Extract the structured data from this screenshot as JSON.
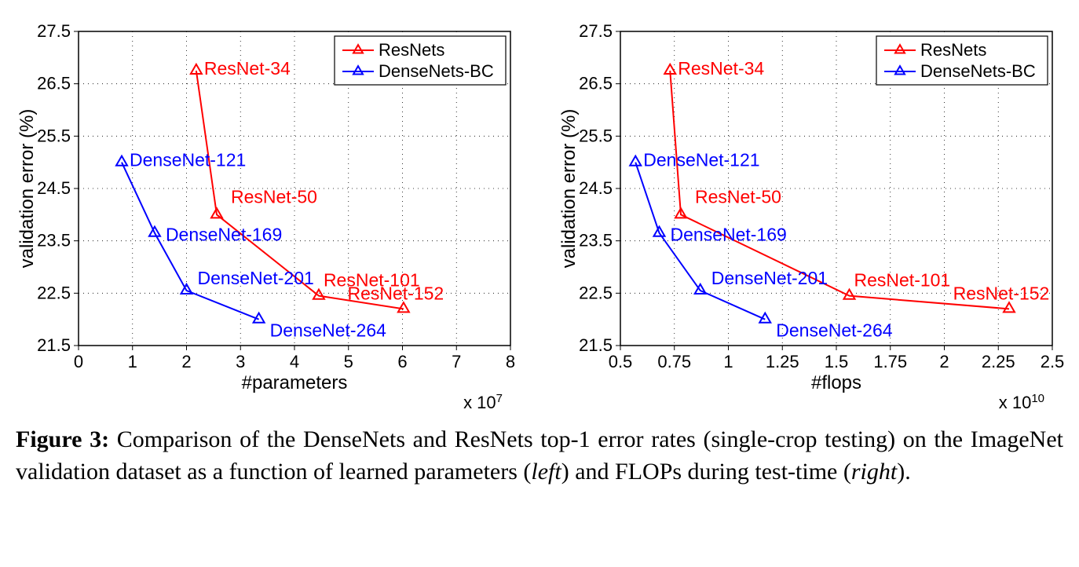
{
  "caption": {
    "lead": "Figure 3:",
    "body": " Comparison of the DenseNets and ResNets top-1 error rates (single-crop testing) on the ImageNet validation dataset as a function of learned parameters (",
    "left": "left",
    "mid": ") and FLOPs during test-time (",
    "right": "right",
    "end": ")."
  },
  "legend": {
    "resnets": "ResNets",
    "densenets": "DenseNets-BC"
  },
  "left_chart": {
    "ylabel": "validation error (%)",
    "xlabel": "#parameters",
    "exp": "x 10",
    "exp_sup": "7",
    "xticks": [
      "0",
      "1",
      "2",
      "3",
      "4",
      "5",
      "6",
      "7",
      "8"
    ],
    "yticks": [
      "21.5",
      "22.5",
      "23.5",
      "24.5",
      "25.5",
      "26.5",
      "27.5"
    ],
    "points": {
      "r34": "ResNet-34",
      "r50": "ResNet-50",
      "r101": "ResNet-101",
      "r152": "ResNet-152",
      "d121": "DenseNet-121",
      "d169": "DenseNet-169",
      "d201": "DenseNet-201",
      "d264": "DenseNet-264"
    }
  },
  "right_chart": {
    "ylabel": "validation error (%)",
    "xlabel": "#flops",
    "exp": "x 10",
    "exp_sup": "10",
    "xticks": [
      "0.5",
      "0.75",
      "1",
      "1.25",
      "1.5",
      "1.75",
      "2",
      "2.25",
      "2.5"
    ],
    "yticks": [
      "21.5",
      "22.5",
      "23.5",
      "24.5",
      "25.5",
      "26.5",
      "27.5"
    ],
    "points": {
      "r34": "ResNet-34",
      "r50": "ResNet-50",
      "r101": "ResNet-101",
      "r152": "ResNet-152",
      "d121": "DenseNet-121",
      "d169": "DenseNet-169",
      "d201": "DenseNet-201",
      "d264": "DenseNet-264"
    }
  },
  "chart_data": [
    {
      "type": "line",
      "title": "",
      "xlabel": "#parameters (x 10^7)",
      "ylabel": "validation error (%)",
      "xlim": [
        0,
        8
      ],
      "ylim": [
        21.5,
        27.5
      ],
      "legend_position": "top-right",
      "grid": true,
      "series": [
        {
          "name": "ResNets",
          "color": "#ff0000",
          "points": [
            {
              "label": "ResNet-34",
              "x": 2.18,
              "y": 26.75
            },
            {
              "label": "ResNet-50",
              "x": 2.56,
              "y": 24.0
            },
            {
              "label": "ResNet-101",
              "x": 4.45,
              "y": 22.45
            },
            {
              "label": "ResNet-152",
              "x": 6.02,
              "y": 22.2
            }
          ]
        },
        {
          "name": "DenseNets-BC",
          "color": "#0000ff",
          "points": [
            {
              "label": "DenseNet-121",
              "x": 0.8,
              "y": 25.0
            },
            {
              "label": "DenseNet-169",
              "x": 1.41,
              "y": 23.65
            },
            {
              "label": "DenseNet-201",
              "x": 2.0,
              "y": 22.55
            },
            {
              "label": "DenseNet-264",
              "x": 3.34,
              "y": 22.0
            }
          ]
        }
      ]
    },
    {
      "type": "line",
      "title": "",
      "xlabel": "#flops (x 10^10)",
      "ylabel": "validation error (%)",
      "xlim": [
        0.5,
        2.5
      ],
      "ylim": [
        21.5,
        27.5
      ],
      "legend_position": "top-right",
      "grid": true,
      "series": [
        {
          "name": "ResNets",
          "color": "#ff0000",
          "points": [
            {
              "label": "ResNet-34",
              "x": 0.73,
              "y": 26.75
            },
            {
              "label": "ResNet-50",
              "x": 0.78,
              "y": 24.0
            },
            {
              "label": "ResNet-101",
              "x": 1.56,
              "y": 22.45
            },
            {
              "label": "ResNet-152",
              "x": 2.3,
              "y": 22.2
            }
          ]
        },
        {
          "name": "DenseNets-BC",
          "color": "#0000ff",
          "points": [
            {
              "label": "DenseNet-121",
              "x": 0.57,
              "y": 25.0
            },
            {
              "label": "DenseNet-169",
              "x": 0.68,
              "y": 23.65
            },
            {
              "label": "DenseNet-201",
              "x": 0.87,
              "y": 22.55
            },
            {
              "label": "DenseNet-264",
              "x": 1.17,
              "y": 22.0
            }
          ]
        }
      ]
    }
  ]
}
